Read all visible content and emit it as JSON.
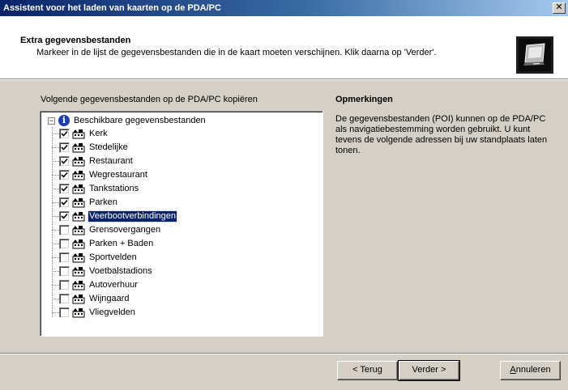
{
  "window": {
    "title": "Assistent voor het laden van kaarten op de PDA/PC",
    "close_glyph": "✕"
  },
  "header": {
    "title": "Extra gegevensbestanden",
    "subtitle": "Markeer in de lijst de gegevensbestanden die in de kaart moeten verschijnen. Klik daarna op 'Verder'.",
    "icon": "pda-device-icon"
  },
  "list": {
    "caption": "Volgende gegevensbestanden op de PDA/PC kopiëren",
    "root_label": "Beschikbare gegevensbestanden",
    "root_expander": "−",
    "items": [
      {
        "label": "Kerk",
        "checked": true
      },
      {
        "label": "Stedelijke",
        "checked": true
      },
      {
        "label": "Restaurant",
        "checked": true
      },
      {
        "label": "Wegrestaurant",
        "checked": true
      },
      {
        "label": "Tankstations",
        "checked": true
      },
      {
        "label": "Parken",
        "checked": true
      },
      {
        "label": "Veerbootverbindingen",
        "checked": true,
        "selected": true
      },
      {
        "label": "Grensovergangen",
        "checked": false
      },
      {
        "label": "Parken + Baden",
        "checked": false
      },
      {
        "label": "Sportvelden",
        "checked": false
      },
      {
        "label": "Voetbalstadions",
        "checked": false
      },
      {
        "label": "Autoverhuur",
        "checked": false
      },
      {
        "label": "Wijngaard",
        "checked": false
      },
      {
        "label": "Vliegvelden",
        "checked": false
      }
    ]
  },
  "remarks": {
    "title": "Opmerkingen",
    "text": "De gegevensbestanden (POI) kunnen op de PDA/PC als navigatiebestemming worden gebruikt. U kunt tevens de volgende adressen bij uw standplaats laten tonen."
  },
  "buttons": {
    "back": "< Terug",
    "next": "Verder >",
    "cancel_accel": "A",
    "cancel_rest": "nnuleren"
  },
  "colors": {
    "titlebar": "#0a246a",
    "dialog_bg": "#d4d0c8",
    "selection": "#0a246a"
  }
}
